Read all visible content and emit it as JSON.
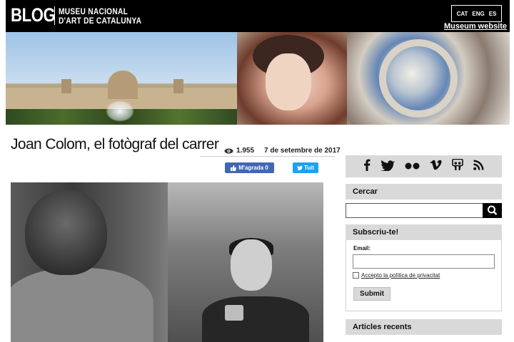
{
  "header": {
    "brand": "BLOG",
    "museum_line1": "MUSEU NACIONAL",
    "museum_line2": "D'ART DE CATALUNYA",
    "languages": [
      "CAT",
      "ENG",
      "ES"
    ],
    "museum_link": "Museum website"
  },
  "article": {
    "title": "Joan Colom, el fotògraf del carrer",
    "views": "1.955",
    "date": "7 de setembre de 2017",
    "like_label": "M'agrada 0",
    "tweet_label": "Tuit"
  },
  "sidebar": {
    "social_icons": [
      "facebook-icon",
      "twitter-icon",
      "flickr-icon",
      "vimeo-icon",
      "slideshare-icon",
      "rss-icon"
    ],
    "search_heading": "Cercar",
    "subscribe_heading": "Subscriu-te!",
    "email_label": "Email:",
    "privacy_label": "Accepto la política de privacitat",
    "submit_label": "Submit",
    "recent_heading": "Articles recents"
  },
  "colors": {
    "header_bg": "#000000",
    "sidebar_block": "#d9d9d9",
    "facebook_blue": "#4267b2",
    "twitter_blue": "#1da1f2"
  }
}
